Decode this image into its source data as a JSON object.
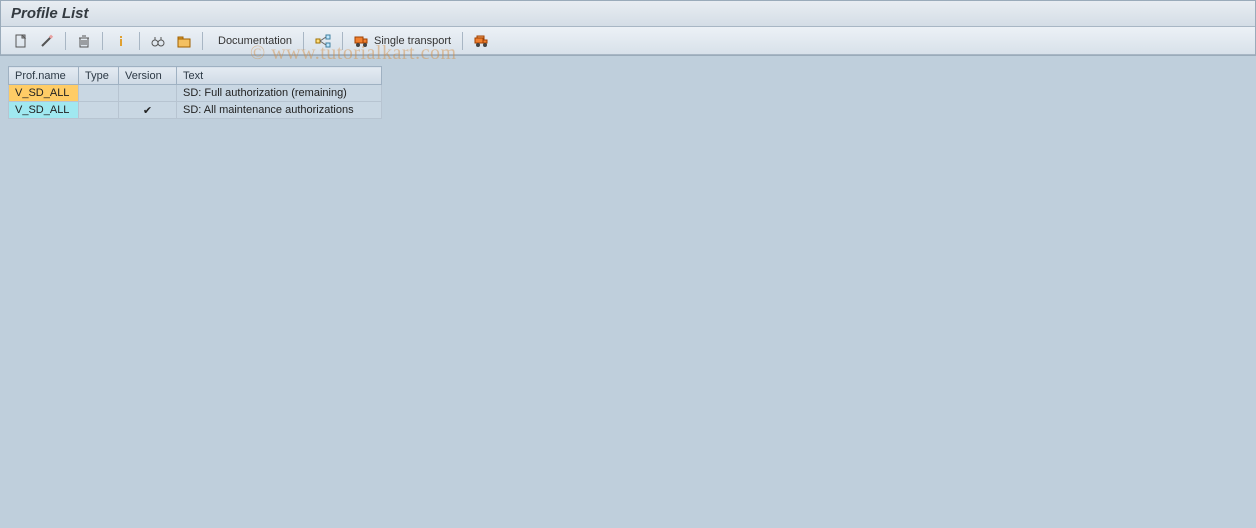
{
  "title": "Profile List",
  "toolbar": {
    "documentation_label": "Documentation",
    "single_transport_label": "Single transport"
  },
  "table": {
    "headers": {
      "prof_name": "Prof.name",
      "type": "Type",
      "version": "Version",
      "text": "Text"
    },
    "rows": [
      {
        "prof_name": "V_SD_ALL",
        "type": "",
        "version": "",
        "text": "SD: Full authorization (remaining)",
        "highlight": "orange"
      },
      {
        "prof_name": "V_SD_ALL",
        "type": "",
        "version": "✔",
        "text": "SD: All maintenance authorizations",
        "highlight": "cyan"
      }
    ]
  },
  "watermark": "© www.tutorialkart.com"
}
